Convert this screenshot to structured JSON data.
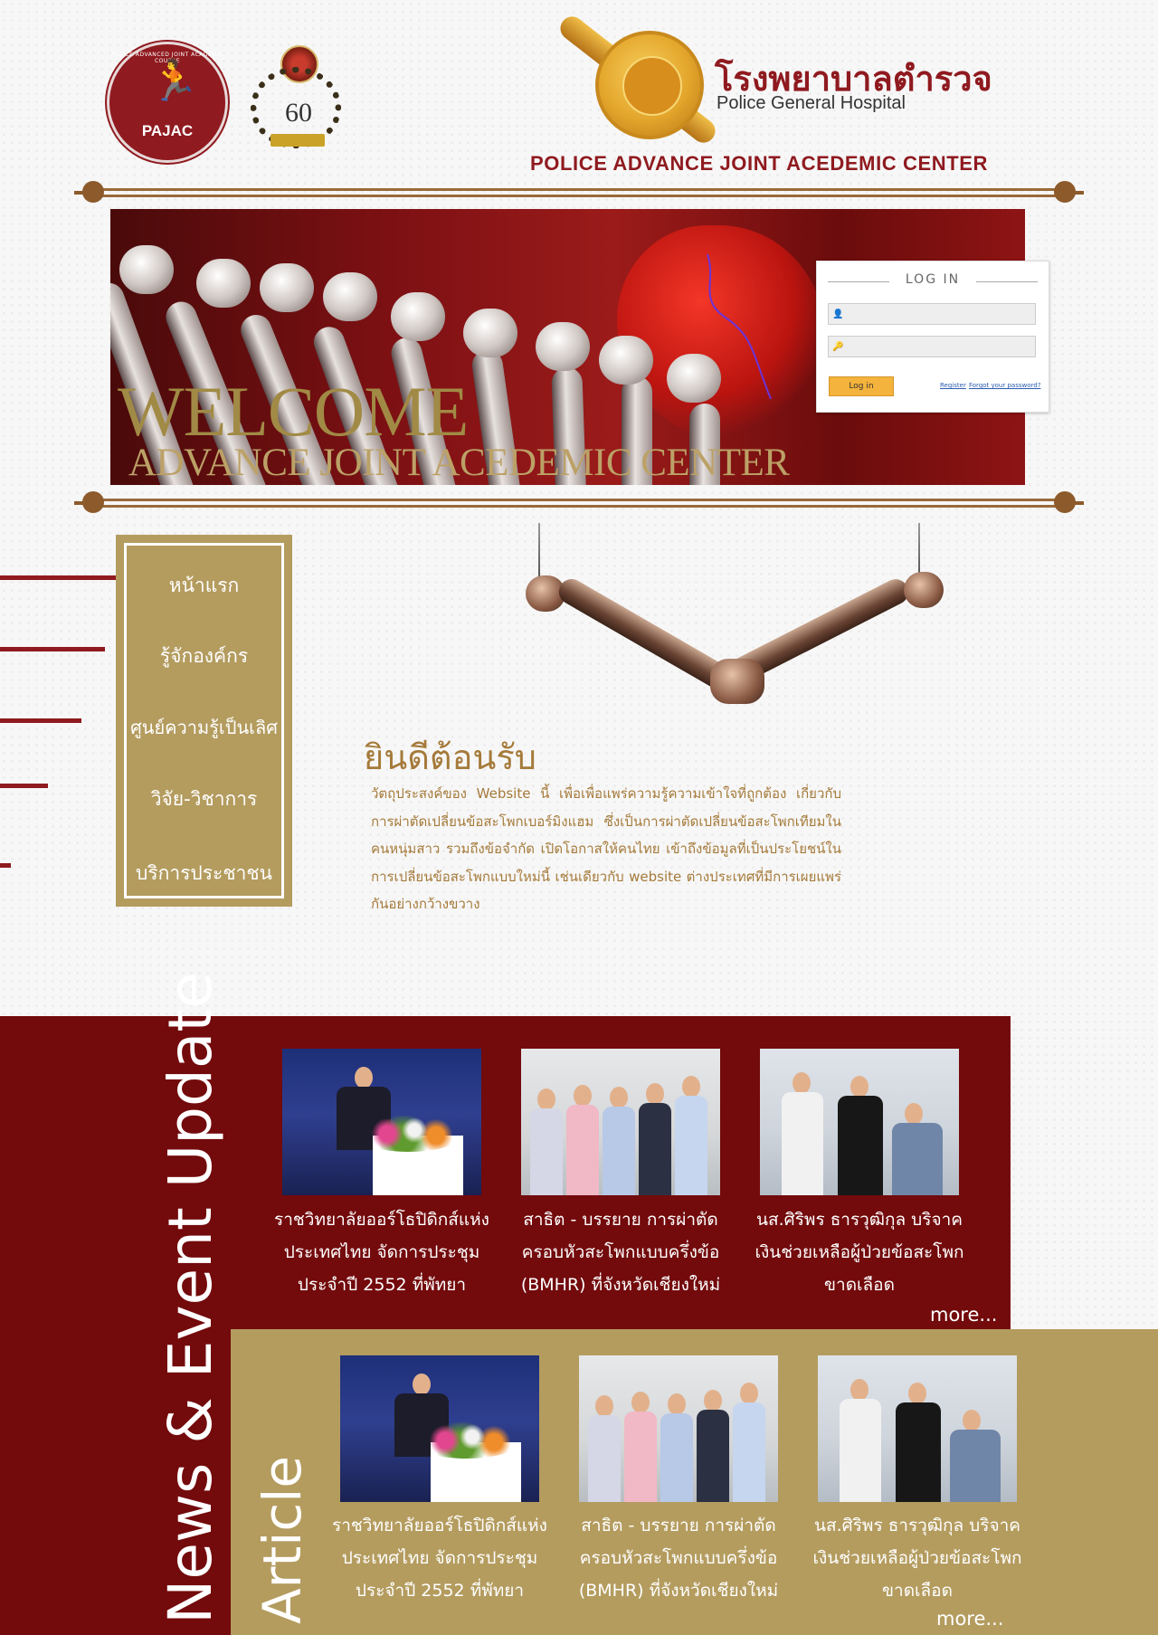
{
  "header": {
    "pajac_logo_text": "PAJAC",
    "pajac_ring_text": "POLICE ADVANCED JOINT ACADEMIC COURSE",
    "anniversary_number": "60",
    "hospital_name_thai": "โรงพยาบาลตำรวจ",
    "hospital_name_en": "Police General Hospital",
    "center_title": "POLICE ADVANCE JOINT ACEDEMIC CENTER"
  },
  "banner": {
    "welcome": "WELCOME",
    "subtitle": "ADVANCE JOINT ACEDEMIC CENTER"
  },
  "login": {
    "title": "LOG IN",
    "username_placeholder": "",
    "password_placeholder": "",
    "login_button": "Log in",
    "register_link": "Register",
    "forgot_link": "Forgot your password?"
  },
  "nav": {
    "items": [
      {
        "label": "หน้าแรก"
      },
      {
        "label": "รู้จักองค์กร"
      },
      {
        "label": "ศูนย์ความรู้เป็นเลิศ"
      },
      {
        "label": "วิจัย-วิชาการ"
      },
      {
        "label": "บริการประชาชน"
      }
    ]
  },
  "welcome": {
    "heading": "ยินดีต้อนรับ",
    "body": "วัตถุประสงค์ของ Website นี้ เพื่อเพื่อแพร่ความรู้ความเข้าใจที่ถูกต้อง เกี่ยวกับการผ่าตัดเปลี่ยนข้อสะโพกเบอร์มิงแฮม ซึ่งเป็นการผ่าตัดเปลี่ยนข้อสะโพกเทียมในคนหนุ่มสาว รวมถึงข้อจำกัด เปิดโอกาสให้คนไทย เข้าถึงข้อมูลที่เป็นประโยชน์ในการเปลี่ยนข้อสะโพกแบบใหม่นี้ เช่นเดียวกับ website ต่างประเทศที่มีการเผยแพร่กันอย่างกว้างขวาง"
  },
  "news": {
    "section_title": "News & Event Update",
    "items": [
      {
        "caption": "ราชวิทยาลัยออร์โธปิดิกส์แห่งประเทศไทย จัดการประชุมประจำปี 2552 ที่พัทยา"
      },
      {
        "caption": "สาธิต - บรรยาย การผ่าตัดครอบหัวสะโพกแบบครึ่งข้อ (BMHR) ที่จังหวัดเชียงใหม่"
      },
      {
        "caption": "นส.ศิริพร ธารวุฒิกุล บริจาคเงินช่วยเหลือผู้ป่วยข้อสะโพกขาดเลือด"
      }
    ],
    "more": "more..."
  },
  "article": {
    "section_title": "Article",
    "items": [
      {
        "caption": "ราชวิทยาลัยออร์โธปิดิกส์แห่งประเทศไทย จัดการประชุมประจำปี 2552 ที่พัทยา"
      },
      {
        "caption": "สาธิต - บรรยาย การผ่าตัดครอบหัวสะโพกแบบครึ่งข้อ (BMHR) ที่จังหวัดเชียงใหม่"
      },
      {
        "caption": "นส.ศิริพร ธารวุฒิกุล บริจาคเงินช่วยเหลือผู้ป่วยข้อสะโพกขาดเลือด"
      }
    ],
    "more": "more..."
  },
  "colors": {
    "maroon": "#730a0c",
    "gold": "#b49c5f",
    "brown_text": "#a57a3a"
  }
}
